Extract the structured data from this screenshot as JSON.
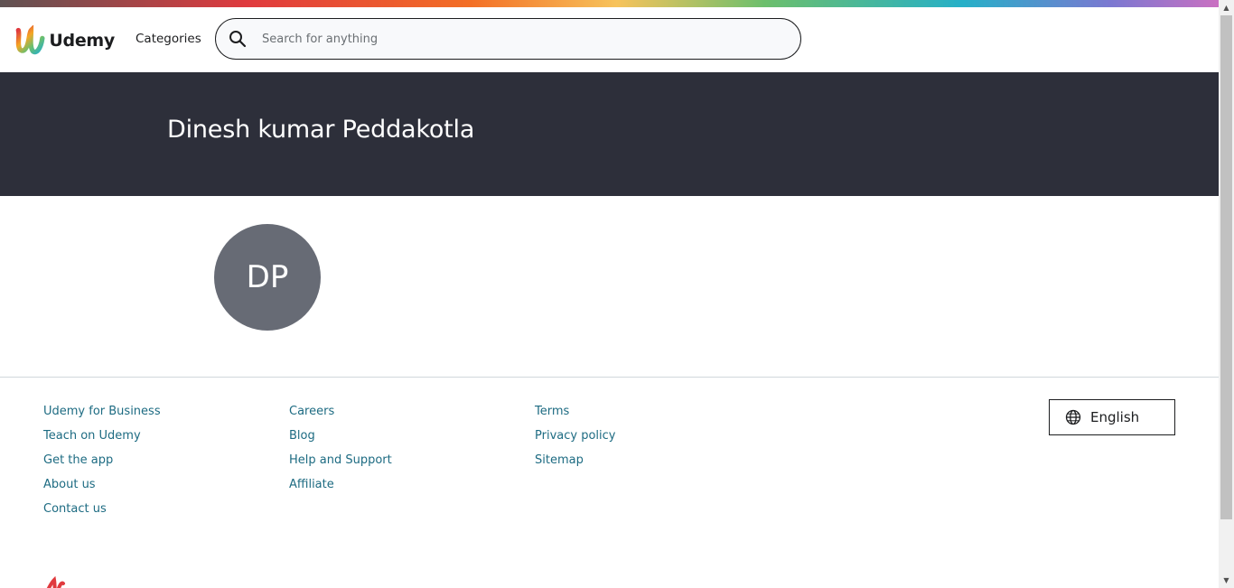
{
  "header": {
    "logo_text": "Udemy",
    "categories_label": "Categories",
    "search_placeholder": "Search for anything",
    "search_value": ""
  },
  "profile": {
    "name": "Dinesh kumar Peddakotla",
    "avatar_initials": "DP"
  },
  "footer": {
    "columns": [
      {
        "links": [
          "Udemy for Business",
          "Teach on Udemy",
          "Get the app",
          "About us",
          "Contact us"
        ]
      },
      {
        "links": [
          "Careers",
          "Blog",
          "Help and Support",
          "Affiliate"
        ]
      },
      {
        "links": [
          "Terms",
          "Privacy policy",
          "Sitemap"
        ]
      }
    ],
    "language_label": "English"
  },
  "icons": {
    "search": "search-icon",
    "language": "globe-icon",
    "logo": "udemy-logo-icon"
  },
  "colors": {
    "banner_bg": "#2d2f3a",
    "link": "#1d6b82",
    "avatar_bg": "#676b75",
    "text": "#1c1d1f"
  }
}
